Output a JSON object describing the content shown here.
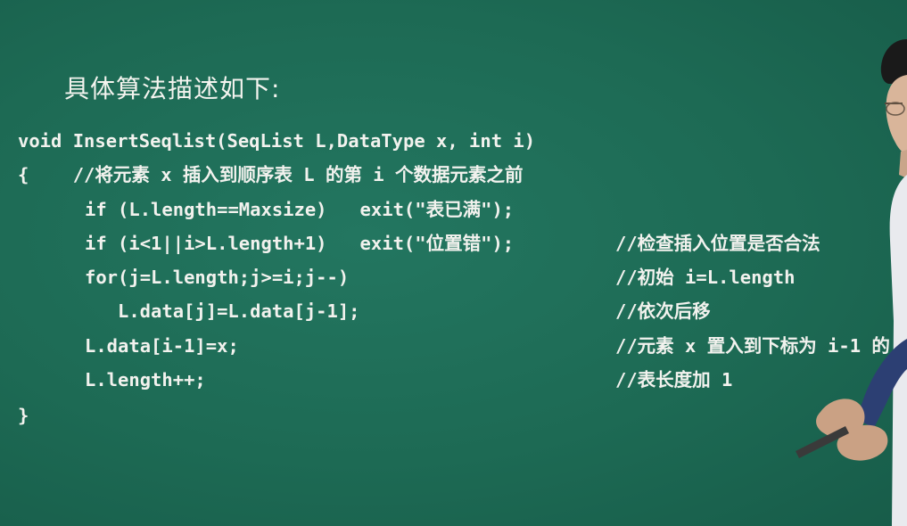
{
  "slide": {
    "heading": "具体算法描述如下:",
    "code_lines": [
      "void InsertSeqlist(SeqList L,DataType x, int i)",
      "{    //将元素 x 插入到顺序表 L 的第 i 个数据元素之前",
      "if (L.length==Maxsize)   exit(\"表已满\");",
      "if (i<1||i>L.length+1)   exit(\"位置错\");",
      "for(j=L.length;j>=i;j--)",
      "L.data[j]=L.data[j-1];",
      "L.data[i-1]=x;",
      "L.length++;",
      "}"
    ],
    "comments": [
      "//检查插入位置是否合法",
      "//初始 i=L.length",
      "//依次后移",
      "//元素 x 置入到下标为 i-1 的",
      "//表长度加 1"
    ]
  },
  "colors": {
    "board": "#1e6b55",
    "text": "#f2f2ee"
  }
}
